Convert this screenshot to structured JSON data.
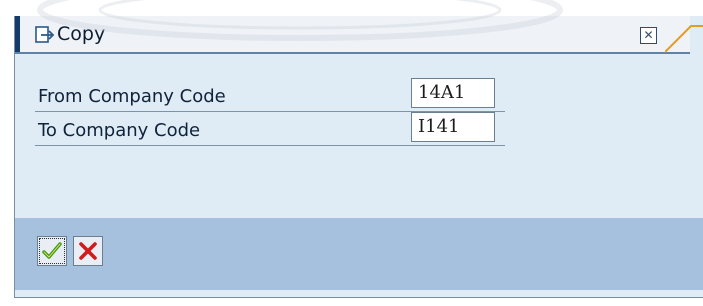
{
  "dialog": {
    "title": "Copy",
    "close_icon": "close-icon",
    "title_icon": "copy-icon"
  },
  "form": {
    "fields": [
      {
        "label": "From Company Code",
        "value": "14A1"
      },
      {
        "label": "To Company Code",
        "value": "I141"
      }
    ]
  },
  "buttons": {
    "confirm_icon": "checkmark-icon",
    "cancel_icon": "cancel-x-icon"
  },
  "colors": {
    "dialog_bg": "#dfebf5",
    "footer_bg": "#a5c1de",
    "title_accent": "#123d68",
    "confirm": "#2e9a1d",
    "cancel": "#d01c1c"
  }
}
